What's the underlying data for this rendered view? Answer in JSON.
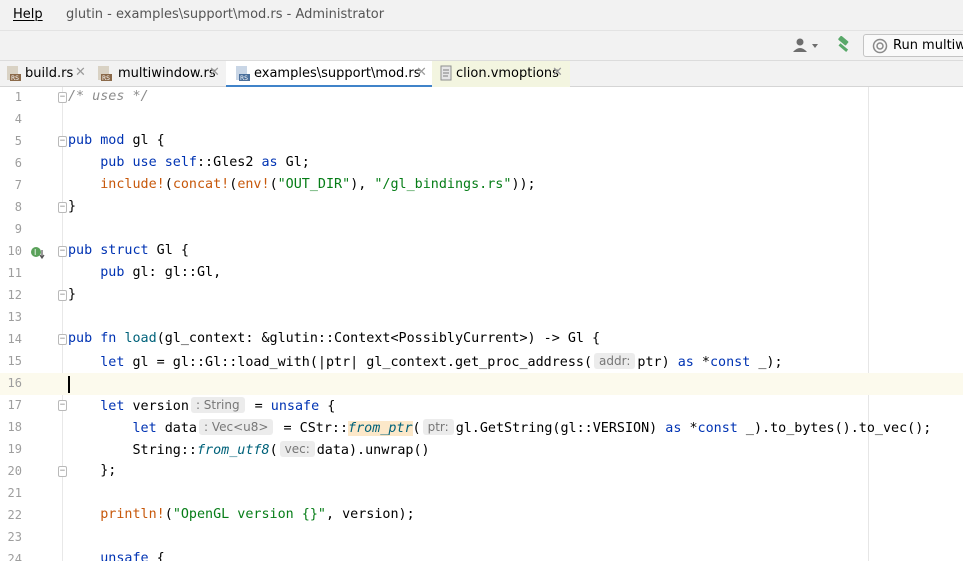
{
  "menu": {
    "help": "Help"
  },
  "window": {
    "title": "glutin - examples\\support\\mod.rs - Administrator"
  },
  "toolbar": {
    "run_label": "Run multiwir",
    "user_icon": "user-dropdown-icon",
    "build_icon": "hammer-icon",
    "run_icon": "run-config-icon"
  },
  "tabs": [
    {
      "label": "build.rs",
      "icon": "rust-file-icon"
    },
    {
      "label": "multiwindow.rs",
      "icon": "rust-file-icon"
    },
    {
      "label": "examples\\support\\mod.rs",
      "icon": "rust-file-icon",
      "active": true
    },
    {
      "label": "clion.vmoptions",
      "icon": "vmoptions-file-icon"
    }
  ],
  "editor": {
    "colors": {
      "keyword": "#0033b3",
      "macro": "#c7580b",
      "string": "#067d17",
      "comment": "#8c8c8c",
      "current_line": "#fcfaed",
      "tab_underline": "#4083c9"
    },
    "line_numbers": [
      "1",
      "4",
      "5",
      "6",
      "7",
      "8",
      "9",
      "10",
      "11",
      "12",
      "13",
      "14",
      "15",
      "16",
      "17",
      "18",
      "19",
      "20",
      "21",
      "22",
      "23",
      "24"
    ],
    "lines": {
      "l1": {
        "comment": "/* uses */"
      },
      "l5": {
        "kw1": "pub",
        "kw2": "mod",
        "rest": " gl {"
      },
      "l6": {
        "kw1": "pub",
        "kw2": "use",
        "kw3": "self",
        "mid": "::Gles2 ",
        "kw4": "as",
        "rest": " Gl;"
      },
      "l7": {
        "m1": "include!",
        "p1": "(",
        "m2": "concat!",
        "p2": "(",
        "m3": "env!",
        "p3": "(",
        "s1": "\"OUT_DIR\"",
        "p4": "), ",
        "s2": "\"/gl_bindings.rs\"",
        "p5": "));"
      },
      "l8": {
        "text": "}"
      },
      "l10": {
        "kw1": "pub",
        "kw2": "struct",
        "rest": " Gl {"
      },
      "l11": {
        "kw1": "pub",
        "rest": " gl: gl::Gl,"
      },
      "l12": {
        "text": "}"
      },
      "l14": {
        "kw1": "pub",
        "kw2": "fn",
        "fnname": "load",
        "rest": "(gl_context: &glutin::Context<PossiblyCurrent>) -> Gl {"
      },
      "l15": {
        "kw1": "let",
        "a": " gl = gl::Gl::load_with(|ptr| gl_context.get_proc_address(",
        "hint": "addr:",
        "b": "ptr) ",
        "kw2": "as",
        "c": " *",
        "kw3": "const",
        "d": " _);"
      },
      "l17": {
        "kw1": "let",
        "a": " version",
        "hint": ": String",
        "b": " = ",
        "kw2": "unsafe",
        "c": " {"
      },
      "l18": {
        "kw1": "let",
        "a": " data",
        "hint": ": Vec<u8>",
        "b": " = CStr::",
        "fn1": "from_ptr",
        "c": "(",
        "hint2": "ptr:",
        "d": "gl.GetString(gl::VERSION) ",
        "kw2": "as",
        "e": " *",
        "kw3": "const",
        "f": " _).to_bytes().to_vec();"
      },
      "l19": {
        "a": "String::",
        "fn1": "from_utf8",
        "b": "(",
        "hint": "vec:",
        "c": "data).unwrap()"
      },
      "l20": {
        "text": "};"
      },
      "l22": {
        "m1": "println!",
        "a": "(",
        "s1": "\"OpenGL version {}\"",
        "b": ", version);"
      },
      "l24": {
        "kw1": "unsafe",
        "rest": " {"
      }
    }
  }
}
